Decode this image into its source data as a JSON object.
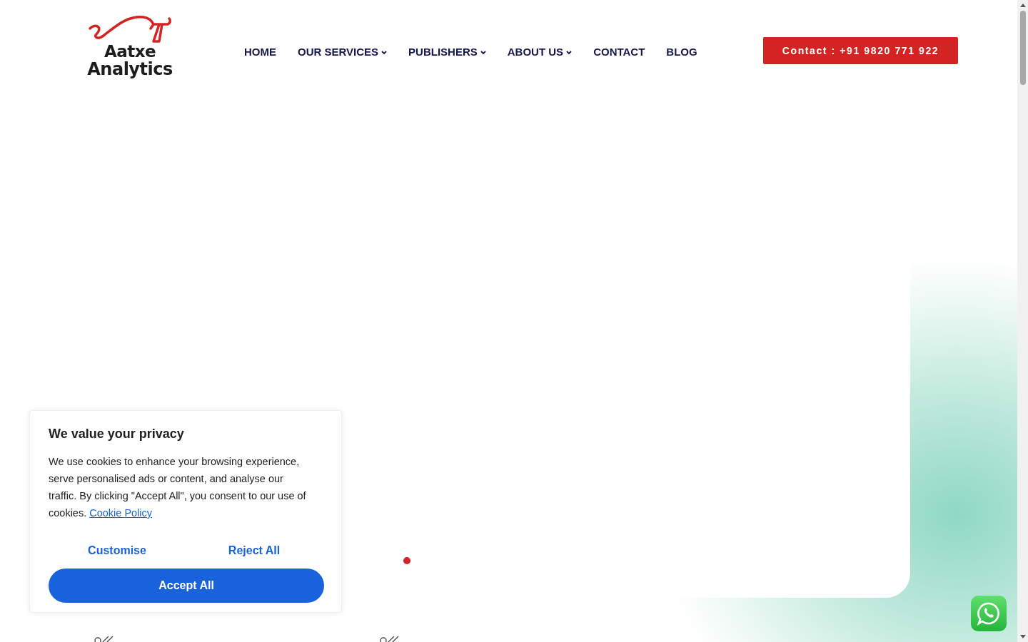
{
  "logo": {
    "line_1": "Aatxe",
    "line_2": "Analytics"
  },
  "nav": [
    {
      "label": "HOME",
      "has_menu": false
    },
    {
      "label": "OUR SERVICES",
      "has_menu": true
    },
    {
      "label": "PUBLISHERS",
      "has_menu": true
    },
    {
      "label": "ABOUT US",
      "has_menu": true
    },
    {
      "label": "CONTACT",
      "has_menu": false
    },
    {
      "label": "BLOG",
      "has_menu": false
    }
  ],
  "contact_button": "Contact : +91 9820 771 922",
  "slider": {
    "dots": [
      {
        "selected": true
      }
    ]
  },
  "cookie_banner": {
    "title": "We value your privacy",
    "text": "We use cookies to enhance your browsing experience, serve personalised ads or content, and analyse our traffic. By clicking \"Accept All\", you consent to our use of cookies.",
    "link": "Cookie Policy",
    "buttons": [
      "Customise",
      "Reject All"
    ],
    "accept": "Accept All"
  }
}
